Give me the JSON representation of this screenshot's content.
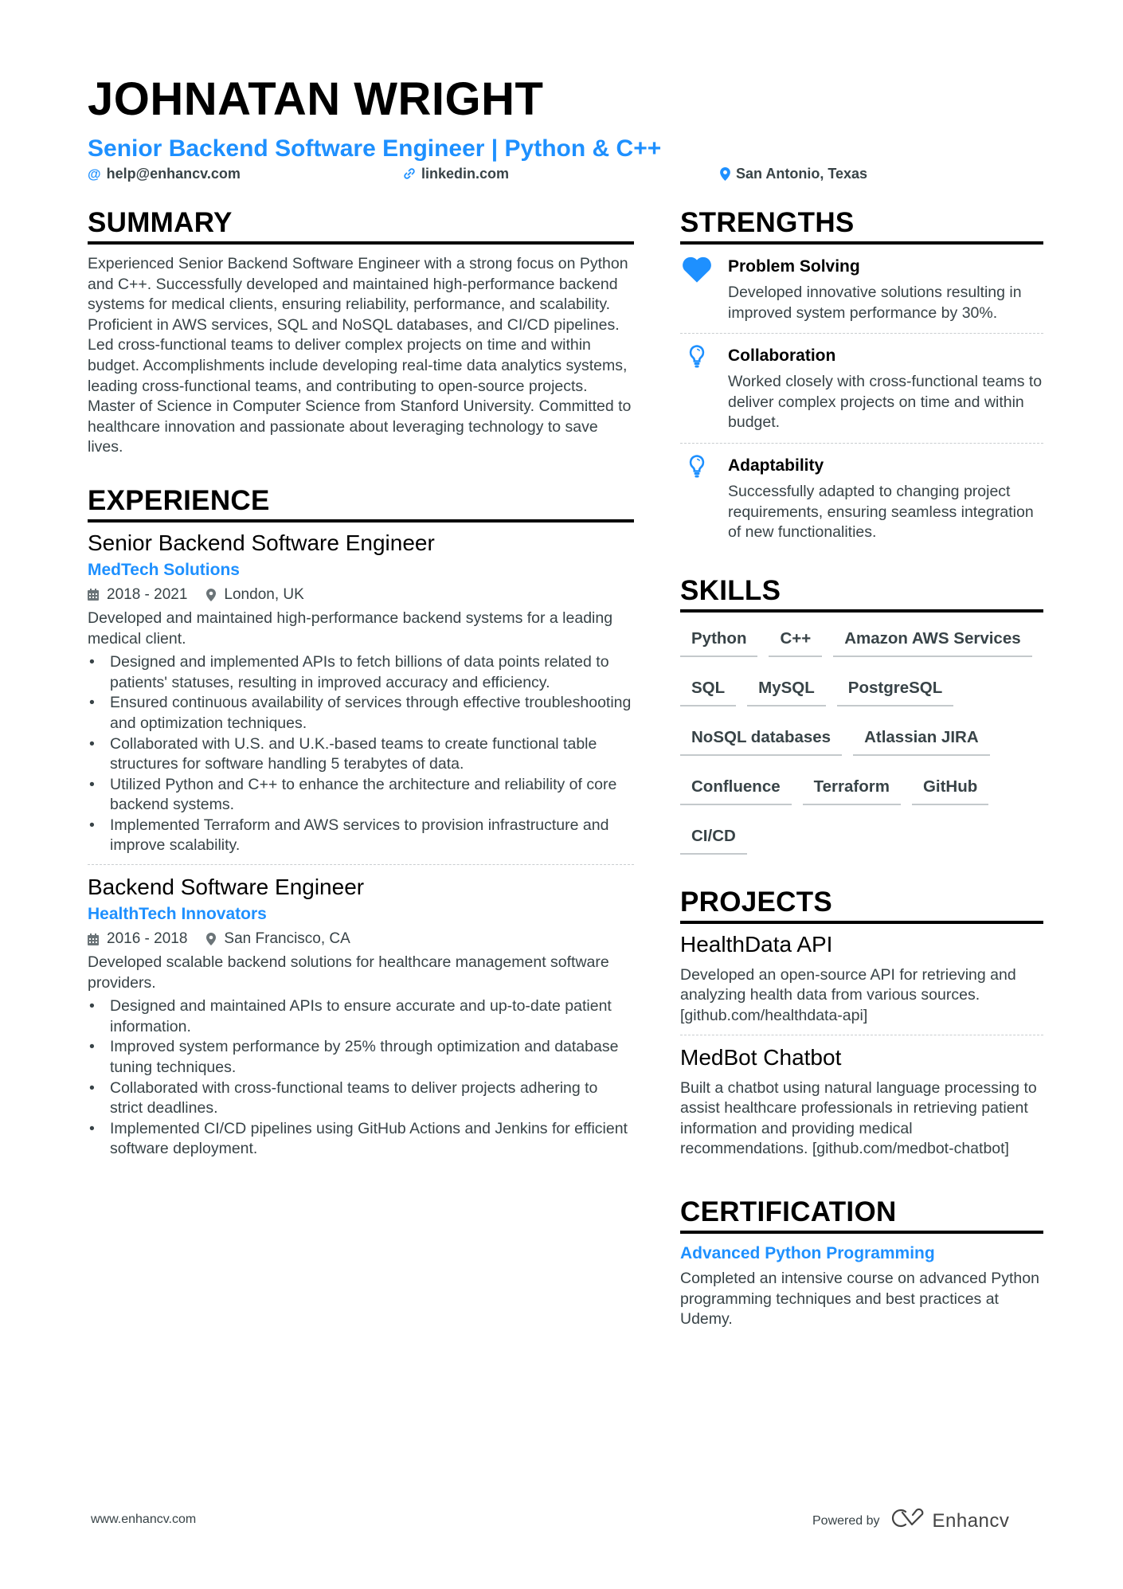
{
  "header": {
    "name": "JOHNATAN WRIGHT",
    "headline": "Senior Backend Software Engineer | Python & C++",
    "contacts": [
      {
        "icon": "at-icon",
        "text": "help@enhancv.com"
      },
      {
        "icon": "link-icon",
        "text": "linkedin.com"
      },
      {
        "icon": "location-pin-icon",
        "text": "San Antonio, Texas"
      }
    ]
  },
  "summary": {
    "title": "SUMMARY",
    "text": "Experienced Senior Backend Software Engineer with a strong focus on Python and C++. Successfully developed and maintained high-performance backend systems for medical clients, ensuring reliability, performance, and scalability. Proficient in AWS services, SQL and NoSQL databases, and CI/CD pipelines. Led cross-functional teams to deliver complex projects on time and within budget. Accomplishments include developing real-time data analytics systems, leading cross-functional teams, and contributing to open-source projects. Master of Science in Computer Science from Stanford University. Committed to healthcare innovation and passionate about leveraging technology to save lives."
  },
  "experience": {
    "title": "EXPERIENCE",
    "items": [
      {
        "role": "Senior Backend Software Engineer",
        "company": "MedTech Solutions",
        "dates": "2018 - 2021",
        "location": "London, UK",
        "description": "Developed and maintained high-performance backend systems for a leading medical client.",
        "bullets": [
          "Designed and implemented APIs to fetch billions of data points related to patients' statuses, resulting in improved accuracy and efficiency.",
          "Ensured continuous availability of services through effective troubleshooting and optimization techniques.",
          "Collaborated with U.S. and U.K.-based teams to create functional table structures for software handling 5 terabytes of data.",
          "Utilized Python and C++ to enhance the architecture and reliability of core backend systems.",
          "Implemented Terraform and AWS services to provision infrastructure and improve scalability."
        ]
      },
      {
        "role": "Backend Software Engineer",
        "company": "HealthTech Innovators",
        "dates": "2016 - 2018",
        "location": "San Francisco, CA",
        "description": "Developed scalable backend solutions for healthcare management software providers.",
        "bullets": [
          "Designed and maintained APIs to ensure accurate and up-to-date patient information.",
          "Improved system performance by 25% through optimization and database tuning techniques.",
          "Collaborated with cross-functional teams to deliver projects adhering to strict deadlines.",
          "Implemented CI/CD pipelines using GitHub Actions and Jenkins for efficient software deployment."
        ]
      }
    ]
  },
  "strengths": {
    "title": "STRENGTHS",
    "items": [
      {
        "icon": "heart-icon",
        "title": "Problem Solving",
        "description": "Developed innovative solutions resulting in improved system performance by 30%."
      },
      {
        "icon": "lightbulb-icon",
        "title": "Collaboration",
        "description": "Worked closely with cross-functional teams to deliver complex projects on time and within budget."
      },
      {
        "icon": "lightbulb-icon",
        "title": "Adaptability",
        "description": "Successfully adapted to changing project requirements, ensuring seamless integration of new functionalities."
      }
    ]
  },
  "skills": {
    "title": "SKILLS",
    "items": [
      "Python",
      "C++",
      "Amazon AWS Services",
      "SQL",
      "MySQL",
      "PostgreSQL",
      "NoSQL databases",
      "Atlassian JIRA",
      "Confluence",
      "Terraform",
      "GitHub",
      "CI/CD"
    ]
  },
  "projects": {
    "title": "PROJECTS",
    "items": [
      {
        "title": "HealthData API",
        "description": "Developed an open-source API for retrieving and analyzing health data from various sources. [github.com/healthdata-api]"
      },
      {
        "title": "MedBot Chatbot",
        "description": "Built a chatbot using natural language processing to assist healthcare professionals in retrieving patient information and providing medical recommendations. [github.com/medbot-chatbot]"
      }
    ]
  },
  "certification": {
    "title": "CERTIFICATION",
    "items": [
      {
        "title": "Advanced Python Programming",
        "description": "Completed an intensive course on advanced Python programming techniques and best practices at Udemy."
      }
    ]
  },
  "footer": {
    "website": "www.enhancv.com",
    "powered_by": "Powered by",
    "brand": "Enhancv"
  },
  "colors": {
    "accent": "#1e90ff",
    "text": "#384347",
    "heading": "#000000",
    "divider": "#c9cdd0"
  }
}
